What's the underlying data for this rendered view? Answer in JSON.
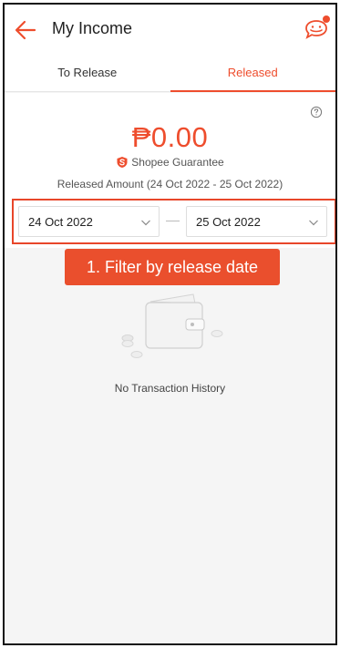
{
  "header": {
    "title": "My Income",
    "back_icon": "arrow-left-icon",
    "chat_icon": "chat-bubble-icon"
  },
  "tabs": [
    {
      "label": "To Release",
      "active": false
    },
    {
      "label": "Released",
      "active": true
    }
  ],
  "summary": {
    "amount": "₱0.00",
    "guarantee": "Shopee Guarantee",
    "released_range": "Released Amount (24 Oct 2022 - 25 Oct 2022)"
  },
  "filter": {
    "start_date": "24 Oct 2022",
    "end_date": "25 Oct 2022"
  },
  "annotation": {
    "text": "1. Filter by release date"
  },
  "empty_state": {
    "message": "No Transaction History"
  },
  "colors": {
    "accent": "#ee4d2d",
    "annotation": "#ea4f2d"
  }
}
